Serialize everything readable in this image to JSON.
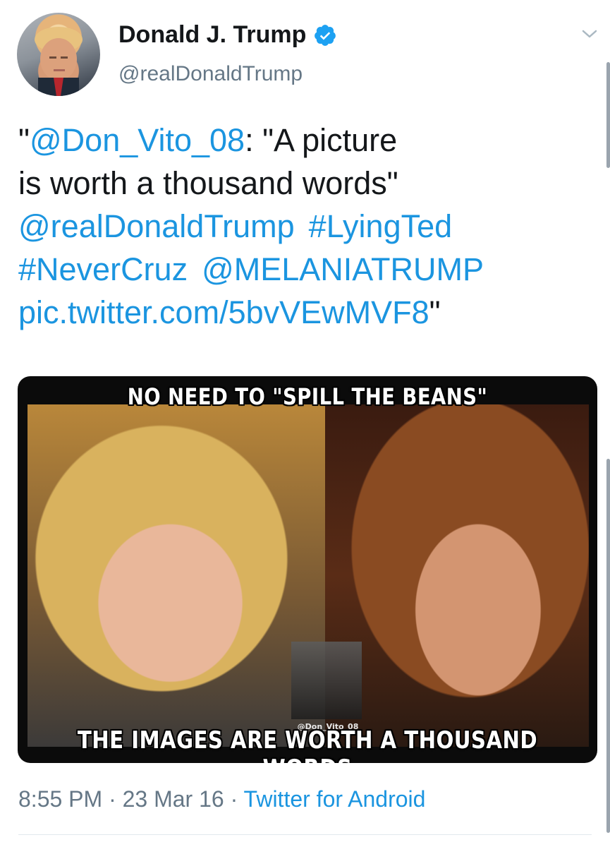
{
  "author": {
    "display_name": "Donald J. Trump",
    "handle": "@realDonaldTrump",
    "verified": true
  },
  "tweet": {
    "quote_open": "\"",
    "mention_1": "@Don_Vito_08",
    "text_1": ": \"A picture",
    "text_2": "is worth a thousand words\"",
    "mention_2": "@realDonaldTrump",
    "hashtag_1": "#LyingTed",
    "hashtag_2": "#NeverCruz",
    "mention_3": "@MELANIATRUMP",
    "pic_link": "pic.twitter.com/5bvVEwMVF8",
    "quote_close": "\""
  },
  "media": {
    "caption_top": "NO NEED TO \"SPILL THE BEANS\"",
    "caption_bottom": "THE IMAGES ARE WORTH A THOUSAND WORDS",
    "watermark": "@Don_Vito_08"
  },
  "meta": {
    "time": "8:55 PM",
    "separator": "·",
    "date": "23 Mar 16",
    "source": "Twitter for Android"
  },
  "colors": {
    "link": "#1b95e0",
    "muted": "#657786",
    "text": "#14171a"
  },
  "icons": {
    "verified": "verified-badge-icon",
    "menu": "chevron-down-icon"
  }
}
